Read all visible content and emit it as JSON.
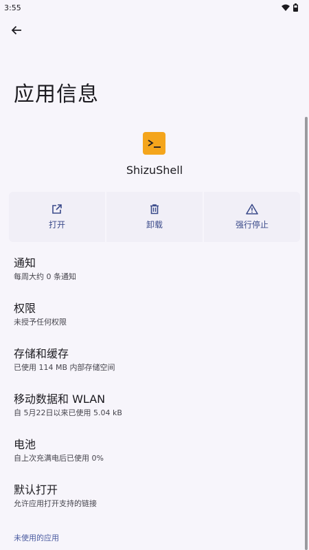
{
  "status_bar": {
    "time": "3:55"
  },
  "header": {
    "title": "应用信息"
  },
  "app": {
    "name": "ShizuShell"
  },
  "actions": {
    "open": "打开",
    "uninstall": "卸载",
    "force_stop": "强行停止"
  },
  "settings": [
    {
      "title": "通知",
      "summary": "每周大约 0 条通知"
    },
    {
      "title": "权限",
      "summary": "未授予任何权限"
    },
    {
      "title": "存储和缓存",
      "summary": "已使用 114 MB 内部存储空间"
    },
    {
      "title": "移动数据和 WLAN",
      "summary": "自 5月22日以来已使用 5.04 kB"
    },
    {
      "title": "电池",
      "summary": "自上次充满电后已使用 0%"
    },
    {
      "title": "默认打开",
      "summary": "允许应用打开支持的链接"
    }
  ],
  "footer": {
    "unused_apps": "未使用的应用"
  },
  "colors": {
    "accent": "#3a4a8a",
    "app_icon_bg": "#f4a51c",
    "background": "#f7f5fb"
  },
  "icons": [
    "back-arrow-icon",
    "wifi-icon",
    "battery-icon",
    "open-external-icon",
    "trash-icon",
    "warning-icon",
    "terminal-icon"
  ]
}
